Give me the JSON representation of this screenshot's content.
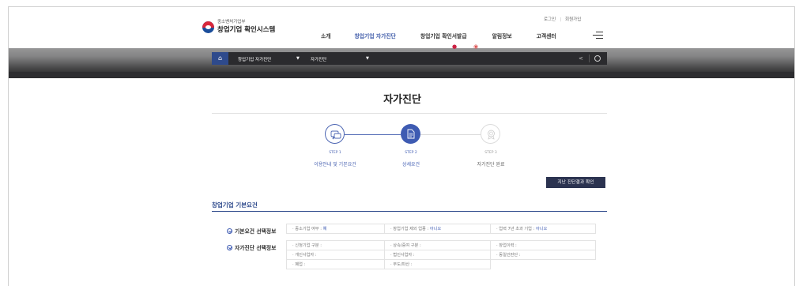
{
  "header": {
    "org": "중소벤처기업부",
    "system_name": "창업기업 확인시스템",
    "util": {
      "login": "로그인",
      "join": "회원가입"
    },
    "nav": [
      "소개",
      "창업기업 자가진단",
      "창업기업 확인서발급",
      "알림정보",
      "고객센터"
    ],
    "active_nav": "창업기업 자가진단"
  },
  "breadcrumb": {
    "home_icon": "home-icon",
    "level1": "창업기업 자가진단",
    "level2": "자가진단"
  },
  "page": {
    "title": "자가진단"
  },
  "steps": [
    {
      "no": "STEP 1",
      "label": "이용안내 및 기본요건",
      "state": "done"
    },
    {
      "no": "STEP 2",
      "label": "상세요건",
      "state": "current"
    },
    {
      "no": "STEP 3",
      "label": "자가진단 완료",
      "state": "todo"
    }
  ],
  "result_button": "지난 진단결과 확인",
  "basic": {
    "section_title": "창업기업 기본요건",
    "row1_label": "기본요건 선택정보",
    "row1": [
      {
        "label": "· 중소기업 여부 : ",
        "value": "예"
      },
      {
        "label": "· 창업기업 제외 업종 : ",
        "value": "아니오"
      },
      {
        "label": "· 업력 7년 초과 기업 : ",
        "value": "아니오"
      }
    ],
    "row2_label": "자가진단 선택정보",
    "row2": [
      "· 신청기업 구분 :",
      "· 상속/증여 구분 :",
      "· 창업이력 :",
      "· 개인사업자 :",
      "· 법인사업자 :",
      "· 동일인판단 :",
      "· 폐업 :",
      "· 부도/파산 :"
    ]
  },
  "colors": {
    "accent": "#3e5bb2",
    "navy_button": "#2b3350",
    "dark_bar": "#2d2d30"
  }
}
